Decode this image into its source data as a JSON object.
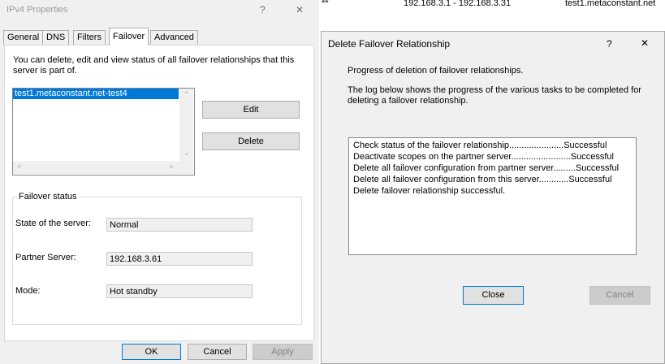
{
  "ipv4": {
    "title": "IPv4 Properties",
    "help": "?",
    "close": "✕",
    "tabs": [
      "General",
      "DNS",
      "Filters",
      "Failover",
      "Advanced"
    ],
    "description": "You can delete, edit and view status of all failover relationships that this server is part of.",
    "relationships": [
      "test1.metaconstant.net-test4"
    ],
    "edit_label": "Edit",
    "delete_label": "Delete",
    "status_group": "Failover status",
    "state_label": "State of the server:",
    "state_value": "Normal",
    "partner_label": "Partner Server:",
    "partner_value": "192.168.3.61",
    "mode_label": "Mode:",
    "mode_value": "Hot standby",
    "ok": "OK",
    "cancel": "Cancel",
    "apply": "Apply"
  },
  "background": {
    "marker": "**",
    "range": "192.168.3.1 - 192.168.3.31",
    "server": "test1.metaconstant.net"
  },
  "delete_dialog": {
    "title": "Delete Failover Relationship",
    "help": "?",
    "close": "✕",
    "progress_text": "Progress of deletion of failover relationships.",
    "log_intro": "The log below shows the progress of the various tasks to be completed for deleting a failover relationship.",
    "log": [
      "Check status of the failover relationship......................Successful",
      "Deactivate scopes on the partner server........................Successful",
      "Delete all failover configuration from partner server.........Successful",
      "Delete all failover configuration from this server............Successful",
      "Delete failover relationship successful."
    ],
    "close_label": "Close",
    "cancel_label": "Cancel"
  },
  "colors": {
    "selection": "#0078d7",
    "dialog_bg": "#f0f0f0"
  }
}
